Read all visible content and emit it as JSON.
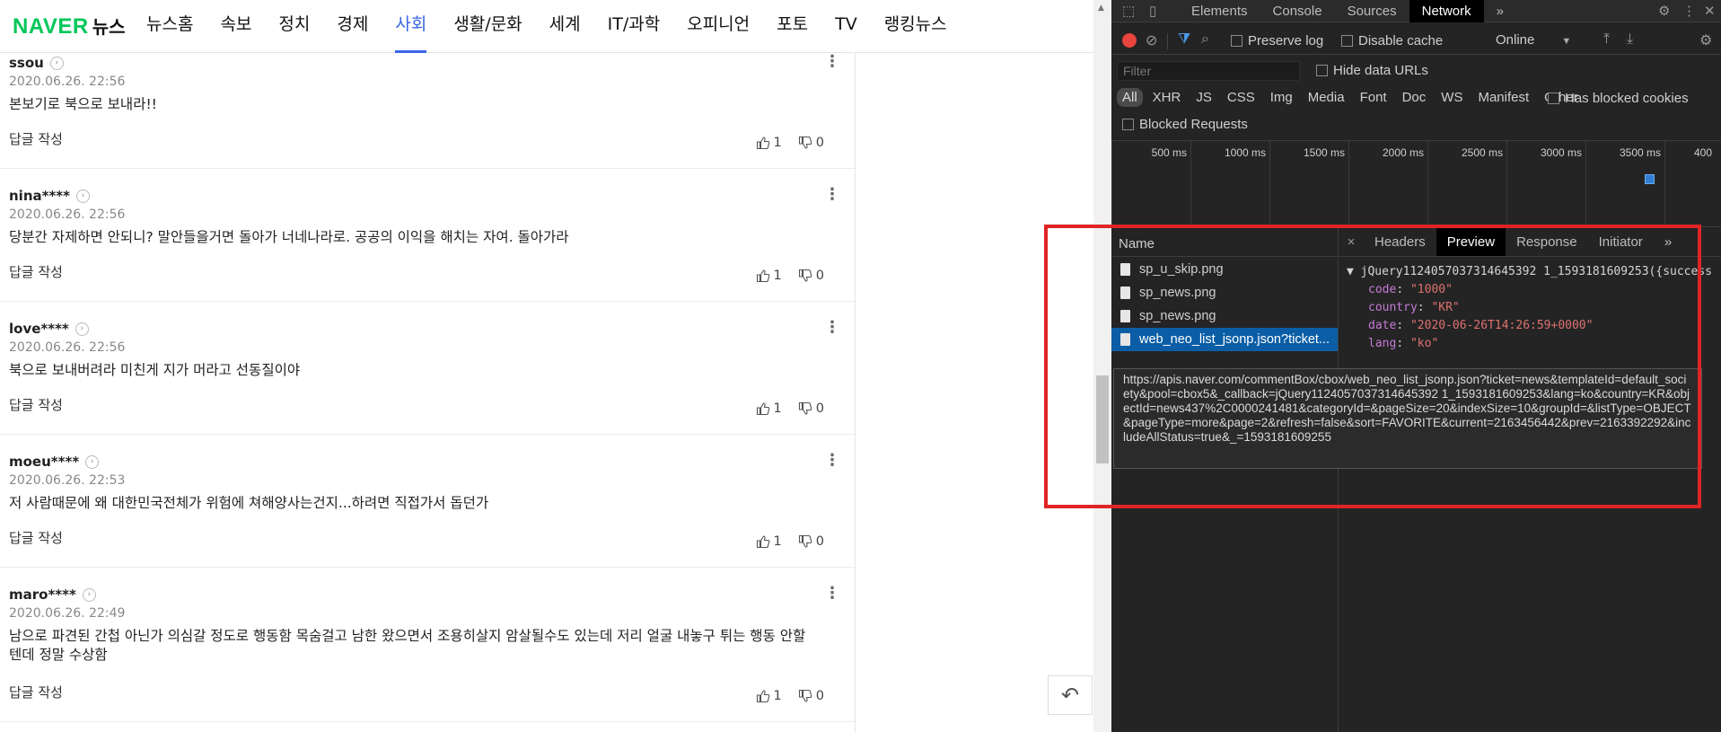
{
  "nav": {
    "brand": "NAVER",
    "service": "뉴스",
    "items": [
      "뉴스홈",
      "속보",
      "정치",
      "경제",
      "사회",
      "생활/문화",
      "세계",
      "IT/과학",
      "오피니언",
      "포토",
      "TV",
      "랭킹뉴스"
    ],
    "active": "사회"
  },
  "comments": [
    {
      "nick": "ssou",
      "date": "2020.06.26. 22:56",
      "text": "본보기로 북으로 보내라!!",
      "reply": "답글 작성",
      "likes": "1",
      "dislikes": "0"
    },
    {
      "nick": "nina****",
      "date": "2020.06.26. 22:56",
      "text": "당분간 자제하면 안되니? 말안들을거면 돌아가 너네나라로. 공공의 이익을 해치는 자여. 돌아가라",
      "reply": "답글 작성",
      "likes": "1",
      "dislikes": "0"
    },
    {
      "nick": "love****",
      "date": "2020.06.26. 22:56",
      "text": "북으로 보내버려라 미친게 지가 머라고 선동질이야",
      "reply": "답글 작성",
      "likes": "1",
      "dislikes": "0"
    },
    {
      "nick": "moeu****",
      "date": "2020.06.26. 22:53",
      "text": "저 사람때문에 왜 대한민국전체가 위험에 쳐해양사는건지...하려면 직접가서 돕던가",
      "reply": "답글 작성",
      "likes": "1",
      "dislikes": "0"
    },
    {
      "nick": "maro****",
      "date": "2020.06.26. 22:49",
      "text": "남으로 파견된 간첩 아닌가 의심갈 정도로 행동함 목숨걸고 남한 왔으면서 조용히살지 암살될수도 있는데 저리 얼굴 내놓구 튀는 행동 안할텐데 정말 수상함",
      "reply": "답글 작성",
      "likes": "1",
      "dislikes": "0"
    }
  ],
  "devtools": {
    "tabs": [
      "Elements",
      "Console",
      "Sources",
      "Network"
    ],
    "active_tab": "Network",
    "more_tabs": "»",
    "preserve_log": "Preserve log",
    "disable_cache": "Disable cache",
    "throttle": "Online",
    "filter_placeholder": "Filter",
    "hide_data_urls": "Hide data URLs",
    "types": [
      "All",
      "XHR",
      "JS",
      "CSS",
      "Img",
      "Media",
      "Font",
      "Doc",
      "WS",
      "Manifest",
      "Other"
    ],
    "active_type": "All",
    "has_blocked_cookies": "Has blocked cookies",
    "blocked_requests": "Blocked Requests",
    "timeline_ticks": [
      "500 ms",
      "1000 ms",
      "1500 ms",
      "2000 ms",
      "2500 ms",
      "3000 ms",
      "3500 ms",
      "400"
    ],
    "name_header": "Name",
    "requests": [
      {
        "name": "sp_u_skip.png",
        "selected": false
      },
      {
        "name": "sp_news.png",
        "selected": false
      },
      {
        "name": "sp_news.png",
        "selected": false
      },
      {
        "name": "web_neo_list_jsonp.json?ticket...",
        "selected": true
      }
    ],
    "preview_tabs": [
      "Headers",
      "Preview",
      "Response",
      "Initiator"
    ],
    "active_preview_tab": "Preview",
    "preview": {
      "root": "jQuery1124057037314645392 1_1593181609253({success",
      "fields": [
        {
          "key": "code",
          "value": "\"1000\""
        },
        {
          "key": "country",
          "value": "\"KR\""
        },
        {
          "key": "date",
          "value": "\"2020-06-26T14:26:59+0000\""
        },
        {
          "key": "lang",
          "value": "\"ko\""
        }
      ]
    },
    "tooltip": "https://apis.naver.com/commentBox/cbox/web_neo_list_jsonp.json?ticket=news&templateId=default_society&pool=cbox5&_callback=jQuery1124057037314645392 1_1593181609253&lang=ko&country=KR&objectId=news437%2C0000241481&categoryId=&pageSize=20&indexSize=10&groupId=&listType=OBJECT&pageType=more&page=2&refresh=false&sort=FAVORITE&current=2163456442&prev=2163392292&includeAllStatus=true&_=1593181609255"
  },
  "colors": {
    "accent": "#03c75a",
    "active_nav": "#3a66e6",
    "highlight": "#e12424",
    "selected_row": "#0b5ea6"
  },
  "icons": {
    "like": "thumbs-up-icon",
    "dislike": "thumbs-down-icon",
    "more": "more-vertical-icon",
    "profile": "chevron-right-icon",
    "back": "undo-arrow-icon"
  }
}
